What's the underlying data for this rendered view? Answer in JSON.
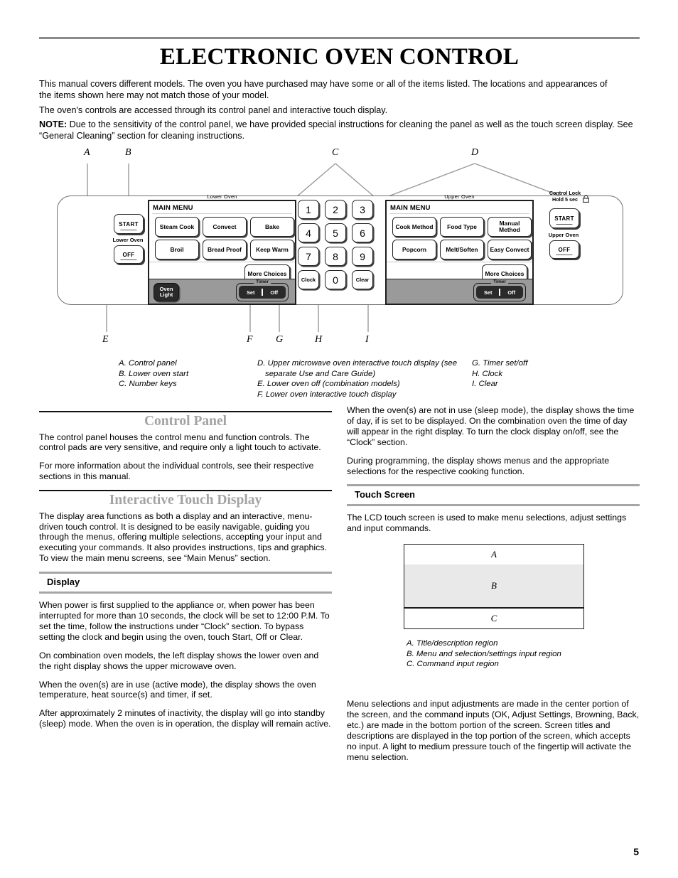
{
  "document": {
    "title": "ELECTRONIC OVEN CONTROL",
    "page_number": "5",
    "intro": {
      "p1": "This manual covers different models. The oven you have purchased may have some or all of the items listed. The locations and appearances of the items shown here may not match those of your model.",
      "p2": "The oven's controls are accessed through its control panel and interactive touch display.",
      "note_label": "NOTE:",
      "note_text": " Due to the sensitivity of the control panel, we have provided special instructions for cleaning the panel as well as the touch screen display. See “General Cleaning” section for cleaning instructions."
    }
  },
  "diagram": {
    "callouts": {
      "a": "A",
      "b": "B",
      "c": "C",
      "d": "D",
      "e": "E",
      "f": "F",
      "g": "G",
      "h": "H",
      "i": "I"
    },
    "lower_side": {
      "start_label": "START",
      "oven_label": "Lower Oven",
      "off_label": "OFF"
    },
    "lower_oven": {
      "caption": "Lower Oven",
      "main_menu": "MAIN MENU",
      "keys": [
        "Steam Cook",
        "Convect",
        "Bake",
        "Broil",
        "Bread Proof",
        "Keep Warm"
      ],
      "more_choices": "More Choices",
      "oven_light": "Oven Light",
      "timer_label": "Timer",
      "timer_set": "Set",
      "timer_off": "Off"
    },
    "numpad": {
      "keys": [
        "1",
        "2",
        "3",
        "4",
        "5",
        "6",
        "7",
        "8",
        "9",
        "Clock",
        "0",
        "Clear"
      ]
    },
    "upper_oven": {
      "caption": "Upper Oven",
      "main_menu": "MAIN MENU",
      "keys": [
        "Cook Method",
        "Food Type",
        "Manual Method",
        "Popcorn",
        "Melt/Soften",
        "Easy Convect"
      ],
      "more_choices": "More Choices",
      "timer_label": "Timer",
      "timer_set": "Set",
      "timer_off": "Off"
    },
    "upper_side": {
      "control_lock_line1": "Control Lock",
      "control_lock_line2": "Hold 5 sec",
      "lock_icon": "lock-icon",
      "start_label": "START",
      "oven_label": "Upper Oven",
      "off_label": "OFF"
    },
    "legend": {
      "col1": [
        "A. Control panel",
        "B. Lower oven start",
        "C. Number keys"
      ],
      "col2": [
        "D. Upper microwave oven interactive touch display (see separate Use and Care Guide)",
        "E. Lower oven off (combination models)",
        "F. Lower oven interactive touch display"
      ],
      "col3": [
        "G. Timer set/off",
        "H. Clock",
        " I. Clear"
      ]
    }
  },
  "sections": {
    "control_panel": {
      "heading": "Control Panel",
      "p1": "The control panel houses the control menu and function controls. The control pads are very sensitive, and require only a light touch to activate.",
      "p2": "For more information about the individual controls, see their respective sections in this manual."
    },
    "interactive_touch_display": {
      "heading": "Interactive Touch Display",
      "p1": "The display area functions as both a display and an interactive, menu-driven touch control. It is designed to be easily navigable, guiding you through the menus, offering multiple selections, accepting your input and executing your commands. It also provides instructions, tips and graphics. To view the main menu screens, see “Main Menus” section."
    },
    "display": {
      "heading": "Display",
      "p1": "When power is first supplied to the appliance or, when power has been interrupted for more than 10 seconds, the clock will be set to 12:00 P.M. To set the time, follow the instructions under “Clock” section. To bypass setting the clock and begin using the oven, touch Start, Off or Clear.",
      "p2": "On combination oven models, the left display shows the lower oven and the right display shows the upper microwave oven.",
      "p3": "When the oven(s) are in use (active mode), the display shows the oven temperature, heat source(s) and timer, if set.",
      "p4": "After approximately 2 minutes of inactivity, the display will go into standby (sleep) mode. When the oven is in operation, the display will remain active."
    },
    "right_top": {
      "p1": "When the oven(s) are not in use (sleep mode), the display shows the time of day, if is set to be displayed. On the combination oven the time of day will appear in the right display. To turn the clock display on/off, see the “Clock” section.",
      "p2": "During programming, the display shows menus and the appropriate selections for the respective cooking function."
    },
    "touch_screen": {
      "heading": "Touch Screen",
      "p1": "The LCD touch screen is used to make menu selections, adjust settings and input commands.",
      "diagram_labels": {
        "a": "A",
        "b": "B",
        "c": "C"
      },
      "caption": [
        "A. Title/description region",
        "B. Menu and selection/settings input region",
        "C. Command input region"
      ],
      "p2": "Menu selections and input adjustments are made in the center portion of the screen, and the command inputs (OK, Adjust Settings, Browning, Back, etc.) are made in the bottom portion of the screen. Screen titles and descriptions are displayed in the top portion of the screen, which accepts no input. A light to medium pressure touch of the fingertip will activate the menu selection."
    }
  },
  "colors": {
    "heading_gray": "#a3a3a3",
    "rule_gray": "#a6a6a6",
    "panel_strip": "#9a9a9a",
    "dark_button": "#2a2a2a"
  }
}
